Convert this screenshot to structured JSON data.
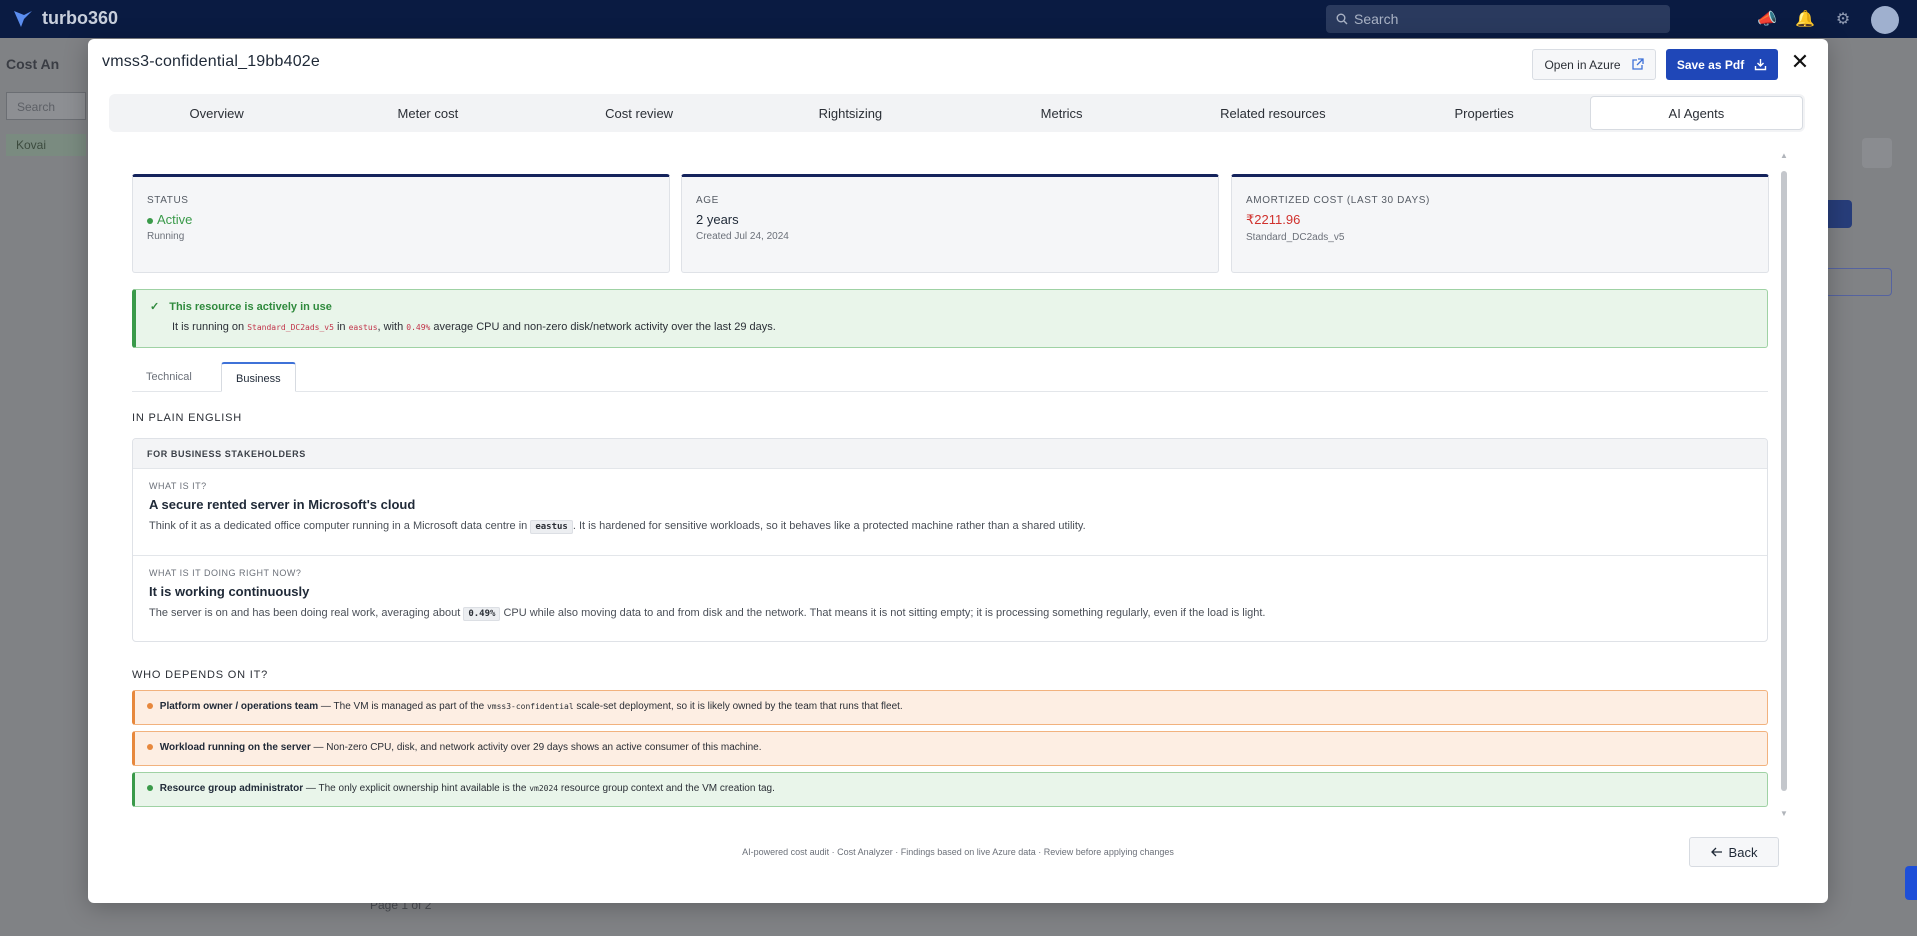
{
  "topbar": {
    "brand": "turbo360",
    "search_placeholder": "Search"
  },
  "background": {
    "page_title": "Cost An",
    "sidebar_search_placeholder": "Search",
    "tree_item": "Kovai",
    "pager_text": "Page 1 of 2"
  },
  "modal": {
    "title": "vmss3-confidential_19bb402e",
    "open_azure_label": "Open in Azure",
    "save_pdf_label": "Save as Pdf",
    "close_symbol": "✕",
    "tabs": [
      "Overview",
      "Meter cost",
      "Cost review",
      "Rightsizing",
      "Metrics",
      "Related resources",
      "Properties",
      "AI Agents"
    ],
    "active_tab": "AI Agents"
  },
  "cards": [
    {
      "label": "STATUS",
      "value": "Active",
      "sub": "Running",
      "color": "#3a9a4a"
    },
    {
      "label": "AGE",
      "value": "2 years",
      "sub": "Created Jul 24, 2024"
    },
    {
      "label": "AMORTIZED COST (LAST 30 DAYS)",
      "value": "₹2211.96",
      "sub": "Standard_DC2ads_v5",
      "color": "#d0312d"
    }
  ],
  "alert": {
    "title": "This resource is actively in use",
    "text_pre": "It is running on ",
    "sku": "Standard_DC2ads_v5",
    "text_in": " in ",
    "region": "eastus",
    "text_with": ", with ",
    "cpu": "0.49%",
    "text_post": " average CPU and non-zero disk/network activity over the last 29 days."
  },
  "subtabs": {
    "technical": "Technical",
    "business": "Business",
    "active": "Business"
  },
  "plain_english": {
    "heading": "IN PLAIN ENGLISH",
    "box_header": "FOR BUSINESS STAKEHOLDERS",
    "items": [
      {
        "question": "WHAT IS IT?",
        "title": "A secure rented server in Microsoft's cloud",
        "text_pre": "Think of it as a dedicated office computer running in a Microsoft data centre in ",
        "chip": "eastus",
        "text_post": ". It is hardened for sensitive workloads, so it behaves like a protected machine rather than a shared utility."
      },
      {
        "question": "WHAT IS IT DOING RIGHT NOW?",
        "title": "It is working continuously",
        "text_pre": "The server is on and has been doing real work, averaging about ",
        "chip": "0.49%",
        "text_post": " CPU while also moving data to and from disk and the network. That means it is not sitting empty; it is processing something regularly, even if the load is light."
      }
    ]
  },
  "dependents": {
    "heading": "WHO DEPENDS ON IT?",
    "items": [
      {
        "name": "Platform owner / operations team",
        "text_pre": " — The VM is managed as part of the ",
        "code": "vmss3-confidential",
        "text_post": " scale-set deployment, so it is likely owned by the team that runs that fleet.",
        "color": "#e7883d"
      },
      {
        "name": "Workload running on the server",
        "text_pre": " — Non-zero CPU, disk, and network activity over 29 days shows an active consumer of this machine.",
        "code": "",
        "text_post": "",
        "color": "#e7883d"
      },
      {
        "name": "Resource group administrator",
        "text_pre": " — The only explicit ownership hint available is the ",
        "code": "vm2024",
        "text_post": " resource group context and the VM creation tag.",
        "color": "#3a9a4a"
      }
    ]
  },
  "footer": {
    "note": "AI-powered cost audit · Cost Analyzer · Findings based on live Azure data · Review before applying changes",
    "back_label": "Back"
  }
}
